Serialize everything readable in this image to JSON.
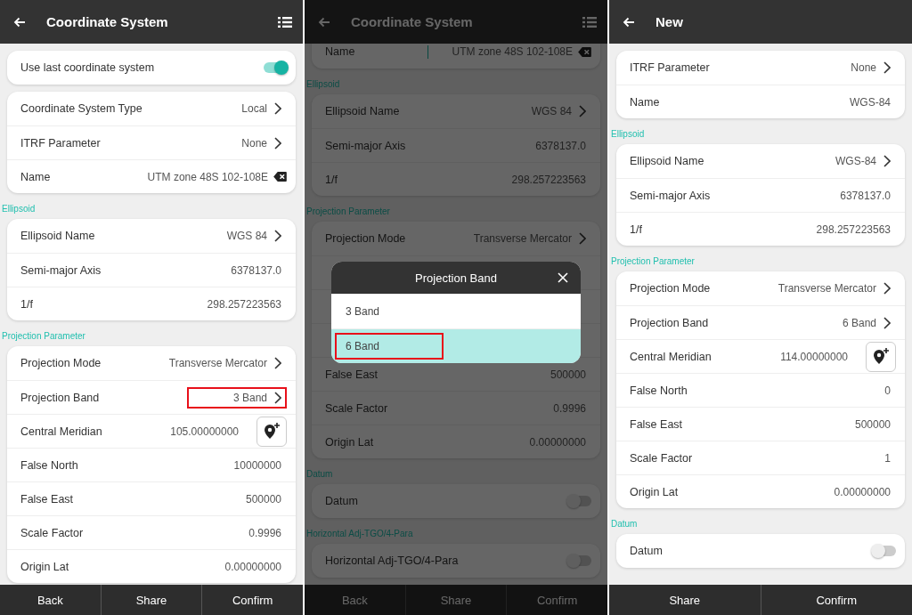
{
  "screens": [
    {
      "title": "Coordinate System",
      "menu": true,
      "dimmed": false,
      "scrolled": false,
      "sections": [
        {
          "rows": [
            {
              "kind": "toggle",
              "label": "Use last coordinate system",
              "on": true
            }
          ]
        },
        {
          "rows": [
            {
              "kind": "select",
              "label": "Coordinate System Type",
              "value": "Local"
            },
            {
              "kind": "select",
              "label": "ITRF Parameter",
              "value": "None"
            },
            {
              "kind": "field",
              "label": "Name",
              "value": "UTM zone 48S 102-108E",
              "cursor": false
            }
          ]
        },
        {
          "heading": "Ellipsoid",
          "rows": [
            {
              "kind": "select",
              "label": "Ellipsoid Name",
              "value": "WGS 84"
            },
            {
              "kind": "text",
              "label": "Semi-major Axis",
              "value": "6378137.0"
            },
            {
              "kind": "text",
              "label": "1/f",
              "value": "298.257223563"
            }
          ]
        },
        {
          "heading": "Projection Parameter",
          "rows": [
            {
              "kind": "select",
              "label": "Projection Mode",
              "value": "Transverse Mercator"
            },
            {
              "kind": "select",
              "label": "Projection Band",
              "value": "3 Band",
              "highlighted": true
            },
            {
              "kind": "locate",
              "label": "Central Meridian",
              "value": "105.00000000"
            },
            {
              "kind": "text",
              "label": "False North",
              "value": "10000000"
            },
            {
              "kind": "text",
              "label": "False East",
              "value": "500000"
            },
            {
              "kind": "text",
              "label": "Scale Factor",
              "value": "0.9996"
            },
            {
              "kind": "text",
              "label": "Origin Lat",
              "value": "0.00000000"
            }
          ]
        }
      ],
      "buttons": [
        "Back",
        "Share",
        "Confirm"
      ]
    },
    {
      "title": "Coordinate System",
      "menu": true,
      "dimmed": true,
      "scrolled": true,
      "sections": [
        {
          "rows": [
            {
              "kind": "field",
              "label": "Name",
              "value": "UTM zone 48S 102-108E",
              "cursor": true
            }
          ]
        },
        {
          "heading": "Ellipsoid",
          "rows": [
            {
              "kind": "select",
              "label": "Ellipsoid Name",
              "value": "WGS 84"
            },
            {
              "kind": "text",
              "label": "Semi-major Axis",
              "value": "6378137.0"
            },
            {
              "kind": "text",
              "label": "1/f",
              "value": "298.257223563"
            }
          ]
        },
        {
          "heading": "Projection Parameter",
          "rows": [
            {
              "kind": "select",
              "label": "Projection Mode",
              "value": "Transverse Mercator"
            },
            {
              "kind": "hidden"
            },
            {
              "kind": "hidden"
            },
            {
              "kind": "hidden"
            },
            {
              "kind": "text",
              "label": "False East",
              "value": "500000"
            },
            {
              "kind": "text",
              "label": "Scale Factor",
              "value": "0.9996"
            },
            {
              "kind": "text",
              "label": "Origin Lat",
              "value": "0.00000000"
            }
          ]
        },
        {
          "heading": "Datum",
          "rows": [
            {
              "kind": "toggle",
              "label": "Datum",
              "on": false
            }
          ]
        },
        {
          "heading": "Horizontal Adj-TGO/4-Para",
          "rows": [
            {
              "kind": "toggle",
              "label": "Horizontal Adj-TGO/4-Para",
              "on": false
            }
          ]
        }
      ],
      "dialog": {
        "title": "Projection Band",
        "options": [
          {
            "label": "3 Band",
            "selected": false,
            "highlighted": false
          },
          {
            "label": "6 Band",
            "selected": true,
            "highlighted": true
          }
        ]
      },
      "buttons": [
        "Back",
        "Share",
        "Confirm"
      ]
    },
    {
      "title": "New",
      "menu": false,
      "dimmed": false,
      "scrolled": false,
      "sections": [
        {
          "rows": [
            {
              "kind": "select",
              "label": "ITRF Parameter",
              "value": "None"
            },
            {
              "kind": "text",
              "label": "Name",
              "value": "WGS-84"
            }
          ]
        },
        {
          "heading": "Ellipsoid",
          "rows": [
            {
              "kind": "select",
              "label": "Ellipsoid Name",
              "value": "WGS-84"
            },
            {
              "kind": "text",
              "label": "Semi-major Axis",
              "value": "6378137.0"
            },
            {
              "kind": "text",
              "label": "1/f",
              "value": "298.257223563"
            }
          ]
        },
        {
          "heading": "Projection Parameter",
          "rows": [
            {
              "kind": "select",
              "label": "Projection Mode",
              "value": "Transverse Mercator"
            },
            {
              "kind": "select",
              "label": "Projection Band",
              "value": "6 Band"
            },
            {
              "kind": "locate",
              "label": "Central Meridian",
              "value": "114.00000000"
            },
            {
              "kind": "text",
              "label": "False North",
              "value": "0"
            },
            {
              "kind": "text",
              "label": "False East",
              "value": "500000"
            },
            {
              "kind": "text",
              "label": "Scale Factor",
              "value": "1"
            },
            {
              "kind": "text",
              "label": "Origin Lat",
              "value": "0.00000000"
            }
          ]
        },
        {
          "heading": "Datum",
          "rows": [
            {
              "kind": "toggle",
              "label": "Datum",
              "on": false
            }
          ]
        }
      ],
      "buttons": [
        "Share",
        "Confirm"
      ]
    }
  ]
}
